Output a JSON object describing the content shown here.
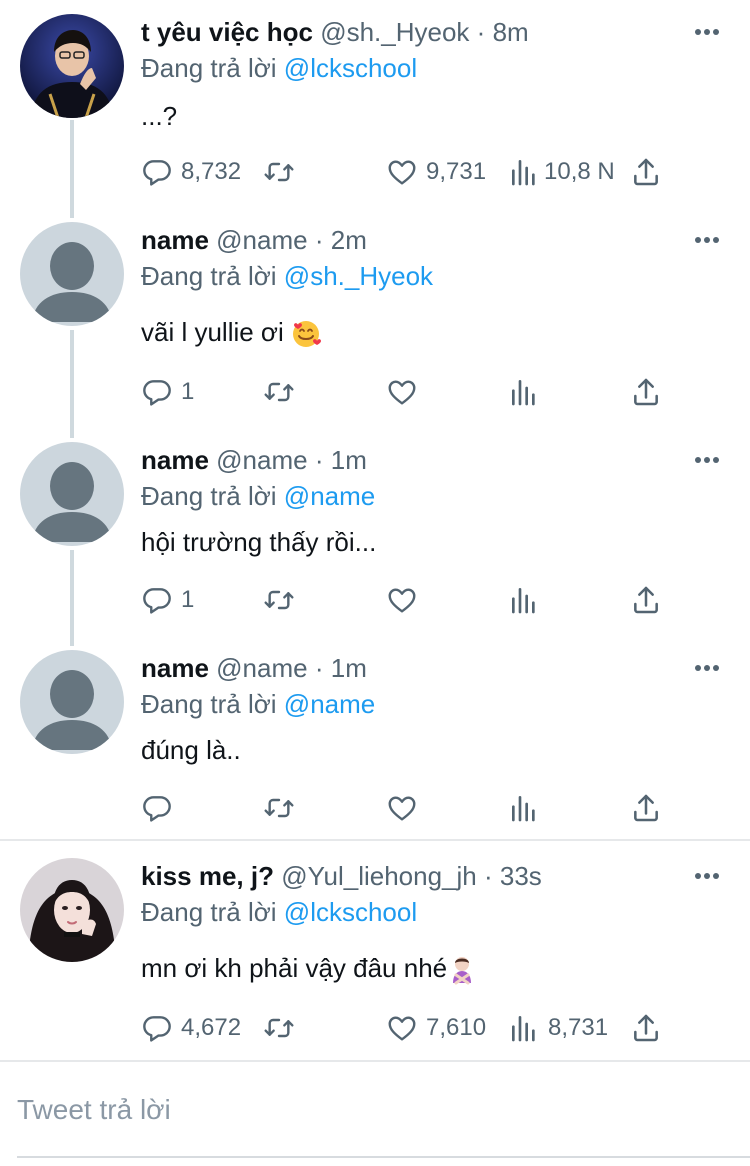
{
  "colors": {
    "link": "#1d9bf0",
    "muted": "#536471",
    "text": "#0f1419",
    "thread_line": "#cfd9de"
  },
  "tweets": [
    {
      "name": "t yêu việc học",
      "handle": "@sh._Hyeok",
      "separator": "·",
      "time": "8m",
      "reply_label": "Đang trả lời",
      "reply_to": "@lckschool",
      "text": "...?",
      "replies": "8,732",
      "retweets": "",
      "likes": "9,731",
      "views": "10,8 N",
      "avatar": "player-photo-avatar"
    },
    {
      "name": "name",
      "handle": "@name",
      "separator": "·",
      "time": "2m",
      "reply_label": "Đang trả lời",
      "reply_to": "@sh._Hyeok",
      "text": "vãi l yullie ơi",
      "text_emoji": "smiling-face-with-hearts",
      "replies": "1",
      "retweets": "",
      "likes": "",
      "views": "",
      "avatar": "default-avatar"
    },
    {
      "name": "name",
      "handle": "@name",
      "separator": "·",
      "time": "1m",
      "reply_label": "Đang trả lời",
      "reply_to": "@name",
      "text": "hội trường thấy rồi...",
      "replies": "1",
      "retweets": "",
      "likes": "",
      "views": "",
      "avatar": "default-avatar"
    },
    {
      "name": "name",
      "handle": "@name",
      "separator": "·",
      "time": "1m",
      "reply_label": "Đang trả lời",
      "reply_to": "@name",
      "text": "đúng là..",
      "replies": "",
      "retweets": "",
      "likes": "",
      "views": "",
      "avatar": "default-avatar"
    },
    {
      "name": "kiss me, j?",
      "handle": "@Yul_liehong_jh",
      "separator": "·",
      "time": "33s",
      "reply_label": "Đang trả lời",
      "reply_to": "@lckschool",
      "text": "mn ơi kh phải vậy đâu nhé",
      "text_emoji": "person-gesturing-no",
      "replies": "4,672",
      "retweets": "",
      "likes": "7,610",
      "views": "8,731",
      "avatar": "girl-photo-avatar"
    }
  ],
  "compose": {
    "placeholder": "Tweet trả lời"
  }
}
